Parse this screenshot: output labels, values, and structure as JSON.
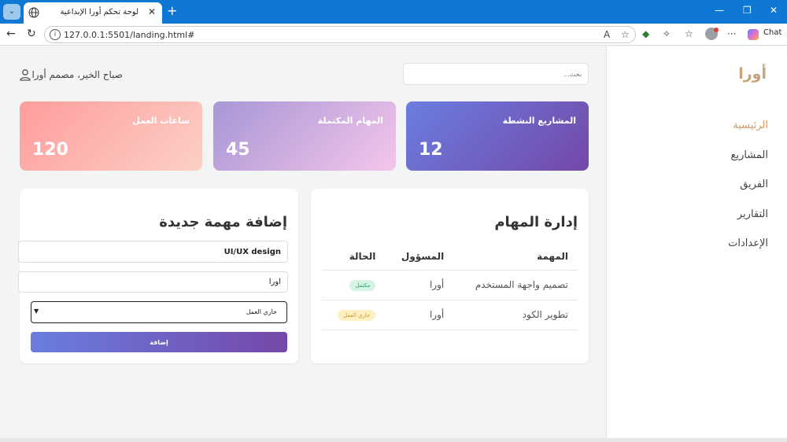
{
  "browser": {
    "tab_title": "لوحة تحكم أورا الإبداعية",
    "tab_close": "✕",
    "new_tab": "+",
    "url": "127.0.0.1:5501/landing.html#",
    "minimize": "—",
    "restore": "❐",
    "close": "✕",
    "chat_label": "Chat"
  },
  "sidebar": {
    "brand": "أورا",
    "items": [
      {
        "label": "الرئيسية",
        "active": true
      },
      {
        "label": "المشاريع",
        "active": false
      },
      {
        "label": "الفريق",
        "active": false
      },
      {
        "label": "التقارير",
        "active": false
      },
      {
        "label": "الإعدادات",
        "active": false
      }
    ]
  },
  "header": {
    "search_placeholder": "بحث...",
    "greeting": "صباح الخير، مصمم أورا"
  },
  "stats": [
    {
      "label": "المشاريع النشطة",
      "value": "12"
    },
    {
      "label": "المهام المكتملة",
      "value": "45"
    },
    {
      "label": "ساعات العمل",
      "value": "120"
    }
  ],
  "tasks": {
    "title": "إدارة المهام",
    "columns": [
      "المهمة",
      "المسؤول",
      "الحالة"
    ],
    "rows": [
      {
        "task": "تصميم واجهة المستخدم",
        "owner": "أورا",
        "status": "مكتمل"
      },
      {
        "task": "تطوير الكود",
        "owner": "أورا",
        "status": "جاري العمل"
      }
    ]
  },
  "add_task": {
    "title": "إضافة مهمة جديدة",
    "task_value": "UI/UX design",
    "owner_value": "اورا",
    "status_selected": "جاري العمل",
    "submit_label": "إضافة"
  },
  "colors": {
    "accent": "#d09a63",
    "brand": "#c9a27a",
    "browser_bar": "#0f78d4",
    "button_gradient_start": "#6a7ee0",
    "button_gradient_end": "#7448a8"
  }
}
